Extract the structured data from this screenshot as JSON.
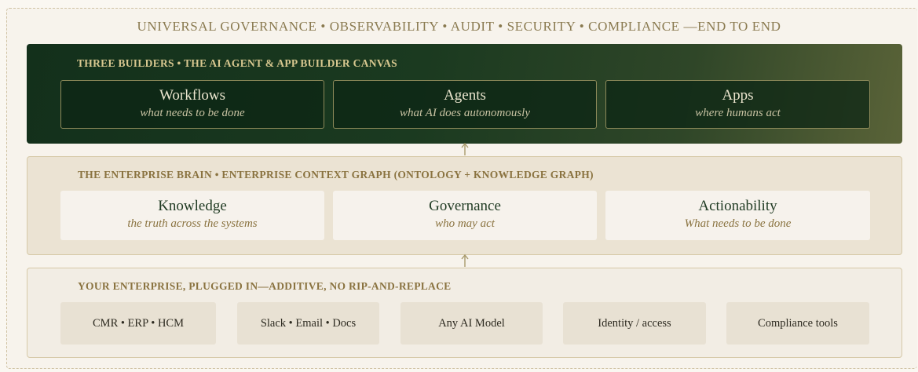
{
  "governance_banner": "UNIVERSAL GOVERNANCE • OBSERVABILITY • AUDIT • SECURITY • COMPLIANCE —END TO END",
  "builders": {
    "title": "THREE BUILDERS • THE AI AGENT & APP BUILDER CANVAS",
    "cards": [
      {
        "name": "Workflows",
        "desc": "what needs to be done"
      },
      {
        "name": "Agents",
        "desc": "what AI does autonomously"
      },
      {
        "name": "Apps",
        "desc": "where humans act"
      }
    ]
  },
  "brain": {
    "title": "THE ENTERPRISE BRAIN • ENTERPRISE CONTEXT GRAPH (ONTOLOGY + KNOWLEDGE GRAPH)",
    "cards": [
      {
        "name": "Knowledge",
        "desc": "the truth across the systems"
      },
      {
        "name": "Governance",
        "desc": "who may act"
      },
      {
        "name": "Actionability",
        "desc": "What needs to be done"
      }
    ]
  },
  "enterprise": {
    "title": "YOUR ENTERPRISE, PLUGGED IN—ADDITIVE, NO RIP-AND-REPLACE",
    "chips": [
      "CMR • ERP • HCM",
      "Slack • Email • Docs",
      "Any AI Model",
      "Identity / access",
      "Compliance tools"
    ]
  },
  "colors": {
    "dark_green": "#13301b",
    "gold": "#8a7340",
    "cream": "#f7f3ec"
  }
}
